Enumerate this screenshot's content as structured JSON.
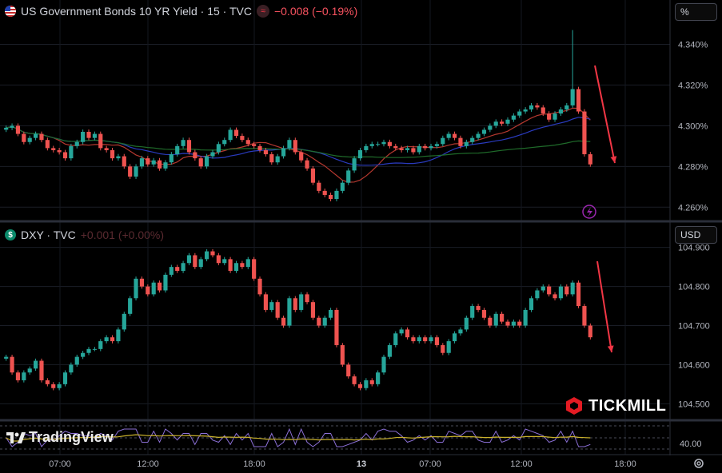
{
  "panel_top": {
    "title": "US Government Bonds 10 YR Yield · 15 · TVC",
    "change": "−0.008 (−0.19%)",
    "unit_button": "%",
    "yticks": [
      "4.340%",
      "4.320%",
      "4.300%",
      "4.280%",
      "4.260%"
    ]
  },
  "panel_bottom": {
    "title": "DXY · TVC",
    "change": "+0.001 (+0.00%)",
    "unit_button": "USD",
    "yticks": [
      "104.900",
      "104.800",
      "104.700",
      "104.600",
      "104.500"
    ]
  },
  "indicator": {
    "ytick": "40.00"
  },
  "time_axis": [
    "07:00",
    "12:00",
    "18:00",
    "13",
    "07:00",
    "12:00",
    "18:00"
  ],
  "brand": {
    "tradingview": "TradingView",
    "broker": "TICKMILL"
  },
  "colors": {
    "up": "#26a69a",
    "down": "#ef5350",
    "arrow": "#f23645",
    "ma_fast": "#b5382f",
    "ma_mid": "#2a3bbf",
    "ma_slow": "#1f6b2a",
    "osc": "#8b6fd6",
    "osc_signal": "#c9b12c"
  },
  "chart_data": [
    {
      "type": "candlestick",
      "title": "US Government Bonds 10 YR Yield · 15 · TVC",
      "ylim": [
        4.255,
        4.35
      ],
      "unit": "%",
      "arrow": "down, near right edge",
      "closes": [
        4.299,
        4.3,
        4.296,
        4.292,
        4.294,
        4.296,
        4.293,
        4.289,
        4.288,
        4.287,
        4.284,
        4.29,
        4.292,
        4.297,
        4.294,
        4.296,
        4.289,
        4.288,
        4.284,
        4.285,
        4.28,
        4.275,
        4.28,
        4.284,
        4.281,
        4.283,
        4.279,
        4.282,
        4.286,
        4.29,
        4.293,
        4.287,
        4.284,
        4.28,
        4.285,
        4.287,
        4.291,
        4.293,
        4.298,
        4.295,
        4.293,
        4.291,
        4.29,
        4.288,
        4.286,
        4.282,
        4.285,
        4.289,
        4.293,
        4.287,
        4.283,
        4.279,
        4.272,
        4.268,
        4.266,
        4.264,
        4.268,
        4.272,
        4.278,
        4.284,
        4.288,
        4.29,
        4.291,
        4.291,
        4.292,
        4.29,
        4.289,
        4.288,
        4.289,
        4.287,
        4.29,
        4.289,
        4.29,
        4.291,
        4.294,
        4.296,
        4.294,
        4.29,
        4.292,
        4.294,
        4.296,
        4.298,
        4.3,
        4.302,
        4.301,
        4.303,
        4.305,
        4.307,
        4.308,
        4.31,
        4.309,
        4.306,
        4.303,
        4.306,
        4.308,
        4.31,
        4.318,
        4.307,
        4.286,
        4.281
      ],
      "special": {
        "spike_index": 96,
        "spike_high": 4.347
      }
    },
    {
      "type": "candlestick",
      "title": "DXY · TVC",
      "ylim": [
        104.47,
        104.93
      ],
      "unit": "USD",
      "arrow": "down, near right edge",
      "closes": [
        104.62,
        104.58,
        104.56,
        104.58,
        104.59,
        104.61,
        104.56,
        104.55,
        104.54,
        104.55,
        104.58,
        104.6,
        104.62,
        104.63,
        104.64,
        104.64,
        104.66,
        104.67,
        104.66,
        104.69,
        104.73,
        104.77,
        104.82,
        104.8,
        104.78,
        104.81,
        104.79,
        104.83,
        104.85,
        104.84,
        104.86,
        104.88,
        104.85,
        104.87,
        104.89,
        104.88,
        104.86,
        104.87,
        104.84,
        104.86,
        104.85,
        104.87,
        104.82,
        104.78,
        104.74,
        104.76,
        104.72,
        104.7,
        104.77,
        104.74,
        104.78,
        104.76,
        104.72,
        104.7,
        104.72,
        104.74,
        104.65,
        104.6,
        104.57,
        104.55,
        104.54,
        104.56,
        104.55,
        104.58,
        104.62,
        104.65,
        104.68,
        104.69,
        104.67,
        104.66,
        104.67,
        104.66,
        104.67,
        104.65,
        104.63,
        104.66,
        104.68,
        104.69,
        104.72,
        104.75,
        104.74,
        104.72,
        104.7,
        104.73,
        104.71,
        104.7,
        104.71,
        104.7,
        104.74,
        104.77,
        104.79,
        104.8,
        104.78,
        104.77,
        104.8,
        104.78,
        104.81,
        104.75,
        104.7,
        104.67
      ]
    }
  ]
}
